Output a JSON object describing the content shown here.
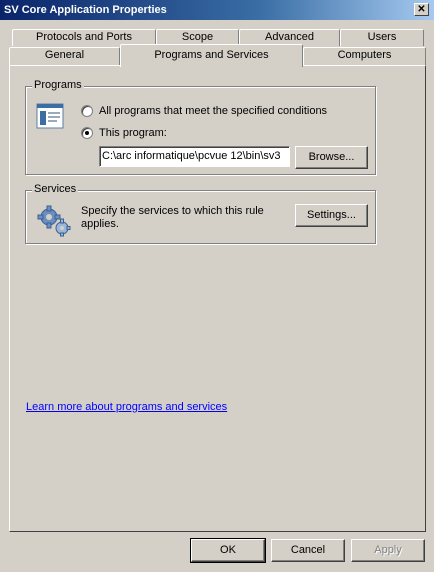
{
  "window": {
    "title": "SV Core Application Properties",
    "close": "✕"
  },
  "tabs": {
    "row1": [
      "Protocols and Ports",
      "Scope",
      "Advanced",
      "Users"
    ],
    "row2": [
      "General",
      "Programs and Services",
      "Computers"
    ],
    "active": "Programs and Services"
  },
  "programs": {
    "label": "Programs",
    "all_label": "All programs that meet the specified conditions",
    "this_label": "This program:",
    "selected": "this",
    "path": "C:\\arc informatique\\pcvue 12\\bin\\sv3",
    "browse": "Browse..."
  },
  "services": {
    "label": "Services",
    "line1": "Specify the services to which this rule",
    "line2": "applies.",
    "settings": "Settings..."
  },
  "learn_more": "Learn more about programs and services",
  "buttons": {
    "ok": "OK",
    "cancel": "Cancel",
    "apply": "Apply"
  },
  "icons": {
    "program": "program-window-icon",
    "services": "gears-icon"
  }
}
